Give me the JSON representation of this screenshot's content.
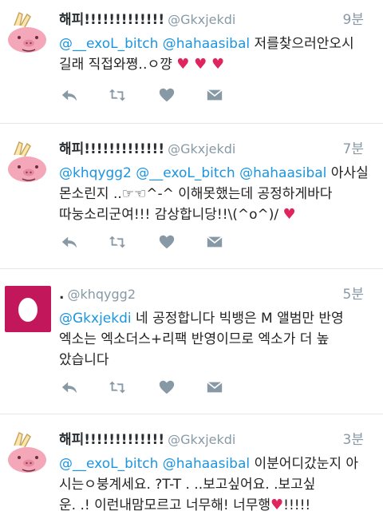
{
  "tweets": [
    {
      "name": "해피!!!!!!!!!!!!!",
      "handle": "@Gkxjekdi",
      "time": "9분",
      "lines": [
        [
          {
            "t": "@__exoL_bitch",
            "m": true
          },
          {
            "t": " "
          },
          {
            "t": "@hahaasibal",
            "m": true
          },
          {
            "t": " 저를찾으러안오시"
          }
        ],
        [
          {
            "t": "길래 직접와쪙‥ㅇ꺙 "
          },
          {
            "t": "♥ ♥ ♥",
            "h": true
          }
        ]
      ]
    },
    {
      "name": "해피!!!!!!!!!!!!!",
      "handle": "@Gkxjekdi",
      "time": "7분",
      "lines": [
        [
          {
            "t": "@khqygg2",
            "m": true
          },
          {
            "t": " "
          },
          {
            "t": "@__exoL_bitch",
            "m": true
          },
          {
            "t": " "
          },
          {
            "t": "@hahaasibal",
            "m": true
          },
          {
            "t": " 아사실"
          }
        ],
        [
          {
            "t": "몬소린지 ..☞☜^-^ 이해못했는데 공정하게바다"
          }
        ],
        [
          {
            "t": "따눙소리군여!!! 감상합니당!!\\(^o^)/ "
          },
          {
            "t": "♥",
            "h": true
          }
        ]
      ]
    },
    {
      "name": ".",
      "handle": "@khqygg2",
      "time": "5분",
      "lines": [
        [
          {
            "t": "@Gkxjekdi",
            "m": true
          },
          {
            "t": " 네 공정합니다 빅뱅은 M 앨범만 반영"
          }
        ],
        [
          {
            "t": "엑소는 엑소더스+리팩 반영이므로 엑소가 더 높"
          }
        ],
        [
          {
            "t": "았습니다"
          }
        ]
      ]
    },
    {
      "name": "해피!!!!!!!!!!!!!",
      "handle": "@Gkxjekdi",
      "time": "3분",
      "lines": [
        [
          {
            "t": "@__exoL_bitch",
            "m": true
          },
          {
            "t": " "
          },
          {
            "t": "@hahaasibal",
            "m": true
          },
          {
            "t": " 이분어디갔눈지 아"
          }
        ],
        [
          {
            "t": "시는ㅇ붕계세요. ?T-T . ..보고싶어요. .보고싶"
          }
        ],
        [
          {
            "t": "운. .! 이런내맘모르고 너무해! 너무행"
          },
          {
            "t": "♥",
            "h": true
          },
          {
            "t": "!!!!!"
          }
        ]
      ]
    }
  ],
  "icons": [
    "reply-icon",
    "retweet-icon",
    "like-icon",
    "message-icon"
  ],
  "colors": {
    "mention": "#1b95e0",
    "muted": "#8899a6",
    "heart": "#e0245e",
    "avatar_pink": "#f4a7b9",
    "egg_bg": "#c2185b"
  }
}
